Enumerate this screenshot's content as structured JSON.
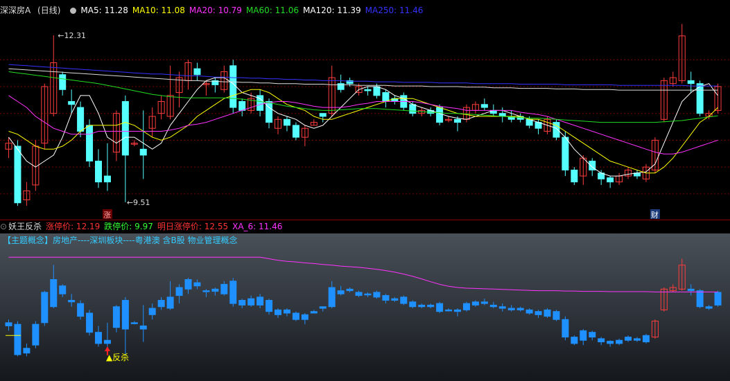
{
  "main_title": "深深房A",
  "period": "(日线)",
  "ma_legend": [
    {
      "label": "MA5: 11.28",
      "color": "#ffffff"
    },
    {
      "label": "MA10: 11.08",
      "color": "#ffff00"
    },
    {
      "label": "MA20: 10.79",
      "color": "#ff33ff"
    },
    {
      "label": "MA60: 11.06",
      "color": "#00ff00"
    },
    {
      "label": "MA120: 11.39",
      "color": "#ffffff"
    },
    {
      "label": "MA250: 11.46",
      "color": "#3333ff"
    }
  ],
  "price_high_label": "12.31",
  "price_low_label": "9.51",
  "marker_zhang": "涨",
  "marker_cai": "财",
  "sub_title": "妖王反杀",
  "sub_legend": [
    {
      "label": "涨停价: 12.19",
      "color": "#ff3333"
    },
    {
      "label": "跌停价: 9.97",
      "color": "#33ff33"
    },
    {
      "label": "明日涨停价: 12.55",
      "color": "#ff3333"
    },
    {
      "label": "XA_6: 11.46",
      "color": "#ff33ff"
    }
  ],
  "concept_text": "【主题概念】房地产----深圳板块----粤港澳 含B股 物业管理概念",
  "signal_label": "反杀",
  "colors": {
    "up": "#ff3c3c",
    "down": "#55ffff",
    "sub_down": "#1e90ff",
    "sub_ma": "#ff33ff"
  },
  "chart_data": {
    "type": "candlestick",
    "ylim": [
      9.3,
      12.6
    ],
    "candles": [
      [
        10.4,
        10.5,
        10.6,
        10.25
      ],
      [
        10.45,
        9.5,
        10.55,
        9.45
      ],
      [
        9.55,
        9.7,
        9.85,
        9.45
      ],
      [
        9.8,
        10.45,
        10.55,
        9.7
      ],
      [
        10.5,
        11.45,
        11.5,
        10.4
      ],
      [
        11.0,
        11.85,
        12.31,
        10.95
      ],
      [
        11.65,
        11.4,
        11.7,
        11.3
      ],
      [
        11.2,
        11.15,
        11.4,
        11.0
      ],
      [
        11.1,
        10.7,
        11.2,
        10.6
      ],
      [
        10.8,
        10.2,
        10.9,
        10.1
      ],
      [
        10.2,
        9.85,
        10.4,
        9.75
      ],
      [
        9.95,
        9.85,
        10.5,
        9.7
      ],
      [
        10.35,
        11.0,
        11.05,
        10.2
      ],
      [
        11.2,
        10.3,
        11.3,
        9.51
      ],
      [
        10.5,
        10.5,
        10.55,
        10.45
      ],
      [
        10.4,
        10.3,
        11.05,
        9.9
      ],
      [
        10.75,
        10.95,
        11.1,
        10.6
      ],
      [
        11.0,
        11.2,
        11.3,
        10.9
      ],
      [
        10.95,
        11.3,
        11.8,
        10.9
      ],
      [
        11.35,
        11.6,
        11.7,
        11.1
      ],
      [
        11.55,
        11.85,
        11.9,
        11.4
      ],
      [
        11.75,
        11.65,
        11.85,
        11.55
      ],
      [
        11.5,
        11.5,
        11.55,
        11.3
      ],
      [
        11.55,
        11.48,
        11.6,
        11.35
      ],
      [
        11.4,
        11.7,
        11.8,
        11.35
      ],
      [
        11.8,
        11.1,
        11.9,
        11.0
      ],
      [
        11.2,
        11.05,
        11.25,
        10.95
      ],
      [
        11.05,
        11.25,
        11.35,
        11.0
      ],
      [
        11.3,
        11.05,
        11.4,
        10.95
      ],
      [
        11.2,
        10.85,
        11.25,
        10.75
      ],
      [
        10.75,
        10.9,
        10.95,
        10.65
      ],
      [
        10.9,
        10.8,
        10.95,
        10.7
      ],
      [
        10.8,
        10.6,
        10.85,
        10.55
      ],
      [
        10.6,
        10.75,
        10.8,
        10.45
      ],
      [
        10.8,
        10.85,
        10.9,
        10.8
      ],
      [
        11.0,
        10.95,
        11.0,
        10.85
      ],
      [
        11.0,
        11.6,
        11.8,
        10.95
      ],
      [
        11.5,
        11.4,
        11.65,
        11.35
      ],
      [
        11.55,
        11.5,
        11.6,
        11.45
      ],
      [
        11.35,
        11.45,
        11.5,
        11.3
      ],
      [
        11.4,
        11.38,
        11.45,
        11.3
      ],
      [
        11.45,
        11.3,
        11.5,
        11.25
      ],
      [
        11.35,
        11.2,
        11.4,
        11.1
      ],
      [
        11.25,
        11.2,
        11.3,
        11.15
      ],
      [
        11.3,
        11.1,
        11.35,
        11.05
      ],
      [
        11.15,
        11.0,
        11.2,
        10.95
      ],
      [
        11.0,
        11.05,
        11.1,
        10.95
      ],
      [
        11.05,
        11.0,
        11.1,
        10.95
      ],
      [
        11.1,
        10.85,
        11.15,
        10.8
      ],
      [
        10.9,
        10.9,
        10.95,
        10.85
      ],
      [
        10.9,
        10.85,
        10.95,
        10.7
      ],
      [
        10.9,
        11.1,
        11.15,
        10.85
      ],
      [
        11.05,
        11.15,
        11.2,
        11.0
      ],
      [
        11.15,
        11.1,
        11.25,
        11.05
      ],
      [
        11.05,
        11.0,
        11.15,
        10.95
      ],
      [
        11.0,
        10.95,
        11.1,
        10.85
      ],
      [
        10.95,
        10.9,
        11.05,
        10.85
      ],
      [
        10.95,
        10.9,
        11.0,
        10.85
      ],
      [
        10.9,
        10.8,
        10.95,
        10.75
      ],
      [
        10.85,
        10.75,
        10.9,
        10.65
      ],
      [
        10.7,
        10.9,
        10.95,
        10.65
      ],
      [
        10.85,
        10.6,
        10.9,
        10.55
      ],
      [
        10.6,
        10.05,
        10.7,
        9.95
      ],
      [
        10.05,
        9.85,
        10.1,
        9.8
      ],
      [
        9.95,
        10.25,
        10.3,
        9.8
      ],
      [
        10.2,
        10.05,
        10.25,
        9.95
      ],
      [
        10.0,
        9.9,
        10.05,
        9.8
      ],
      [
        9.92,
        9.85,
        9.95,
        9.75
      ],
      [
        9.85,
        9.95,
        10.0,
        9.8
      ],
      [
        9.95,
        10.05,
        10.1,
        9.9
      ],
      [
        10.0,
        9.95,
        10.05,
        9.9
      ],
      [
        9.9,
        10.1,
        10.15,
        9.85
      ],
      [
        10.05,
        10.55,
        10.6,
        10.0
      ],
      [
        10.9,
        11.55,
        11.6,
        10.85
      ],
      [
        11.5,
        11.6,
        11.7,
        11.45
      ],
      [
        11.55,
        12.3,
        12.5,
        11.5
      ],
      [
        11.55,
        11.5,
        11.7,
        11.35
      ],
      [
        11.5,
        11.0,
        11.55,
        10.95
      ],
      [
        10.95,
        11.0,
        11.05,
        10.9
      ],
      [
        11.05,
        11.45,
        11.5,
        11.0
      ]
    ],
    "ma_series": [
      {
        "name": "MA5",
        "color": "#ffffff",
        "values": [
          10.6,
          10.4,
          10.2,
          10.1,
          10.2,
          10.3,
          10.6,
          11.0,
          11.3,
          11.3,
          11.0,
          10.6,
          10.5,
          10.6,
          10.6,
          10.5,
          10.4,
          10.5,
          10.8,
          11.0,
          11.2,
          11.4,
          11.55,
          11.6,
          11.6,
          11.5,
          11.35,
          11.3,
          11.25,
          11.1,
          11.0,
          10.95,
          10.9,
          10.8,
          10.75,
          10.8,
          10.95,
          11.1,
          11.25,
          11.4,
          11.45,
          11.45,
          11.4,
          11.3,
          11.25,
          11.15,
          11.1,
          11.05,
          11.0,
          10.95,
          10.92,
          10.9,
          10.95,
          11.0,
          11.05,
          11.05,
          11.0,
          10.95,
          10.9,
          10.85,
          10.8,
          10.75,
          10.6,
          10.4,
          10.25,
          10.1,
          10.0,
          9.95,
          9.95,
          9.98,
          10.0,
          10.02,
          10.15,
          10.5,
          10.85,
          11.2,
          11.35,
          11.45,
          11.5,
          11.3
        ]
      },
      {
        "name": "MA10",
        "color": "#ffff00",
        "values": [
          10.7,
          10.65,
          10.55,
          10.45,
          10.4,
          10.4,
          10.45,
          10.55,
          10.7,
          10.8,
          10.8,
          10.8,
          10.8,
          10.85,
          10.8,
          10.7,
          10.6,
          10.55,
          10.6,
          10.7,
          10.8,
          10.95,
          11.05,
          11.15,
          11.25,
          11.3,
          11.35,
          11.4,
          11.4,
          11.35,
          11.25,
          11.15,
          11.1,
          11.05,
          10.95,
          10.9,
          10.9,
          10.95,
          11.0,
          11.05,
          11.1,
          11.15,
          11.2,
          11.25,
          11.25,
          11.25,
          11.2,
          11.15,
          11.1,
          11.05,
          11.0,
          10.98,
          10.95,
          10.95,
          10.95,
          10.95,
          10.95,
          10.95,
          10.9,
          10.9,
          10.85,
          10.8,
          10.7,
          10.6,
          10.5,
          10.4,
          10.3,
          10.2,
          10.15,
          10.1,
          10.05,
          10.0,
          10.0,
          10.1,
          10.25,
          10.45,
          10.65,
          10.85,
          10.95,
          11.1
        ]
      },
      {
        "name": "MA20",
        "color": "#ff33ff",
        "values": [
          11.3,
          11.2,
          11.1,
          10.95,
          10.85,
          10.75,
          10.7,
          10.65,
          10.65,
          10.65,
          10.7,
          10.7,
          10.7,
          10.7,
          10.7,
          10.7,
          10.7,
          10.7,
          10.72,
          10.75,
          10.8,
          10.82,
          10.85,
          10.9,
          10.95,
          11.0,
          11.05,
          11.1,
          11.15,
          11.18,
          11.2,
          11.2,
          11.18,
          11.15,
          11.12,
          11.1,
          11.1,
          11.1,
          11.12,
          11.15,
          11.17,
          11.2,
          11.2,
          11.2,
          11.2,
          11.2,
          11.18,
          11.15,
          11.12,
          11.1,
          11.08,
          11.05,
          11.05,
          11.05,
          11.05,
          11.05,
          11.05,
          11.02,
          11.0,
          10.98,
          10.95,
          10.9,
          10.85,
          10.8,
          10.75,
          10.7,
          10.65,
          10.6,
          10.55,
          10.5,
          10.45,
          10.4,
          10.35,
          10.32,
          10.32,
          10.35,
          10.4,
          10.45,
          10.5,
          10.55
        ]
      },
      {
        "name": "MA60",
        "color": "#22dd22",
        "values": [
          11.7,
          11.68,
          11.66,
          11.64,
          11.62,
          11.6,
          11.58,
          11.56,
          11.54,
          11.52,
          11.5,
          11.47,
          11.44,
          11.41,
          11.38,
          11.35,
          11.32,
          11.3,
          11.28,
          11.27,
          11.26,
          11.26,
          11.26,
          11.26,
          11.26,
          11.25,
          11.24,
          11.22,
          11.2,
          11.18,
          11.15,
          11.12,
          11.1,
          11.08,
          11.06,
          11.05,
          11.05,
          11.06,
          11.07,
          11.08,
          11.08,
          11.08,
          11.07,
          11.06,
          11.05,
          11.04,
          11.03,
          11.02,
          11.01,
          11.0,
          11.0,
          10.99,
          10.98,
          10.97,
          10.96,
          10.95,
          10.94,
          10.93,
          10.92,
          10.92,
          10.91,
          10.9,
          10.89,
          10.88,
          10.87,
          10.86,
          10.85,
          10.85,
          10.85,
          10.85,
          10.85,
          10.85,
          10.85,
          10.86,
          10.87,
          10.88,
          10.9,
          10.92,
          10.94,
          10.96
        ]
      },
      {
        "name": "MA120",
        "color": "#dddddd",
        "values": [
          11.75,
          11.74,
          11.73,
          11.72,
          11.71,
          11.7,
          11.69,
          11.68,
          11.67,
          11.66,
          11.65,
          11.64,
          11.63,
          11.62,
          11.61,
          11.6,
          11.59,
          11.58,
          11.57,
          11.56,
          11.55,
          11.55,
          11.54,
          11.54,
          11.53,
          11.53,
          11.52,
          11.52,
          11.51,
          11.51,
          11.5,
          11.5,
          11.5,
          11.49,
          11.49,
          11.49,
          11.48,
          11.48,
          11.48,
          11.47,
          11.47,
          11.47,
          11.47,
          11.46,
          11.46,
          11.46,
          11.46,
          11.45,
          11.45,
          11.45,
          11.45,
          11.44,
          11.44,
          11.44,
          11.43,
          11.43,
          11.43,
          11.42,
          11.42,
          11.42,
          11.42,
          11.41,
          11.41,
          11.41,
          11.4,
          11.4,
          11.4,
          11.4,
          11.39,
          11.39,
          11.39,
          11.39,
          11.39,
          11.39,
          11.39,
          11.39,
          11.39,
          11.39,
          11.39,
          11.39
        ]
      },
      {
        "name": "MA250",
        "color": "#3333ff",
        "values": [
          11.82,
          11.81,
          11.8,
          11.79,
          11.78,
          11.77,
          11.76,
          11.75,
          11.74,
          11.73,
          11.72,
          11.71,
          11.7,
          11.69,
          11.68,
          11.67,
          11.66,
          11.66,
          11.65,
          11.64,
          11.63,
          11.63,
          11.62,
          11.61,
          11.61,
          11.6,
          11.6,
          11.59,
          11.59,
          11.58,
          11.58,
          11.57,
          11.57,
          11.56,
          11.56,
          11.55,
          11.55,
          11.55,
          11.54,
          11.54,
          11.54,
          11.53,
          11.53,
          11.53,
          11.52,
          11.52,
          11.52,
          11.52,
          11.51,
          11.51,
          11.51,
          11.51,
          11.5,
          11.5,
          11.5,
          11.5,
          11.5,
          11.49,
          11.49,
          11.49,
          11.49,
          11.49,
          11.48,
          11.48,
          11.48,
          11.48,
          11.48,
          11.48,
          11.47,
          11.47,
          11.47,
          11.47,
          11.47,
          11.47,
          11.47,
          11.47,
          11.46,
          11.46,
          11.46,
          11.46
        ]
      }
    ],
    "sub_ylim": [
      9.5,
      12.9
    ],
    "sub_ma": {
      "name": "XA_6",
      "color": "#ff33ff",
      "values": [
        12.55,
        12.55,
        12.55,
        12.55,
        12.55,
        12.55,
        12.55,
        12.55,
        12.55,
        12.55,
        12.55,
        12.55,
        12.55,
        12.55,
        12.55,
        12.55,
        12.55,
        12.55,
        12.55,
        12.55,
        12.55,
        12.55,
        12.55,
        12.55,
        12.55,
        12.55,
        12.55,
        12.55,
        12.55,
        12.5,
        12.45,
        12.42,
        12.4,
        12.37,
        12.35,
        12.32,
        12.3,
        12.27,
        12.25,
        12.23,
        12.2,
        12.17,
        12.13,
        12.08,
        12.02,
        11.95,
        11.87,
        11.78,
        11.7,
        11.64,
        11.6,
        11.58,
        11.57,
        11.56,
        11.55,
        11.54,
        11.53,
        11.52,
        11.51,
        11.5,
        11.5,
        11.5,
        11.49,
        11.49,
        11.48,
        11.48,
        11.48,
        11.47,
        11.47,
        11.47,
        11.47,
        11.47,
        11.46,
        11.46,
        11.46,
        11.46,
        11.46,
        11.46,
        11.46,
        11.46
      ]
    }
  }
}
